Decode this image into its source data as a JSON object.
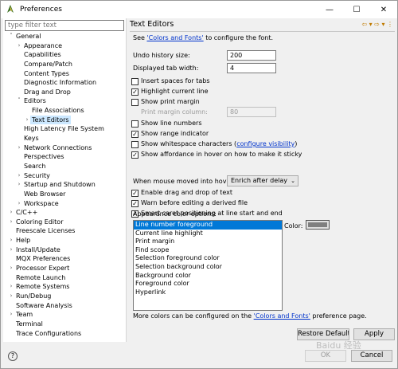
{
  "window": {
    "title": "Preferences",
    "min": "—",
    "max": "☐",
    "close": "✕"
  },
  "filter": {
    "placeholder": "type filter text"
  },
  "tree": [
    {
      "label": "General",
      "depth": 0,
      "chev": "˅"
    },
    {
      "label": "Appearance",
      "depth": 1,
      "chev": "›"
    },
    {
      "label": "Capabilities",
      "depth": 1,
      "chev": ""
    },
    {
      "label": "Compare/Patch",
      "depth": 1,
      "chev": ""
    },
    {
      "label": "Content Types",
      "depth": 1,
      "chev": ""
    },
    {
      "label": "Diagnostic Information",
      "depth": 1,
      "chev": ""
    },
    {
      "label": "Drag and Drop",
      "depth": 1,
      "chev": ""
    },
    {
      "label": "Editors",
      "depth": 1,
      "chev": "˅"
    },
    {
      "label": "File Associations",
      "depth": 2,
      "chev": ""
    },
    {
      "label": "Text Editors",
      "depth": 2,
      "chev": "›",
      "selected": true
    },
    {
      "label": "High Latency File System",
      "depth": 1,
      "chev": ""
    },
    {
      "label": "Keys",
      "depth": 1,
      "chev": ""
    },
    {
      "label": "Network Connections",
      "depth": 1,
      "chev": "›"
    },
    {
      "label": "Perspectives",
      "depth": 1,
      "chev": ""
    },
    {
      "label": "Search",
      "depth": 1,
      "chev": ""
    },
    {
      "label": "Security",
      "depth": 1,
      "chev": "›"
    },
    {
      "label": "Startup and Shutdown",
      "depth": 1,
      "chev": "›"
    },
    {
      "label": "Web Browser",
      "depth": 1,
      "chev": ""
    },
    {
      "label": "Workspace",
      "depth": 1,
      "chev": "›"
    },
    {
      "label": "C/C++",
      "depth": 0,
      "chev": "›"
    },
    {
      "label": "Coloring Editor",
      "depth": 0,
      "chev": "›"
    },
    {
      "label": "Freescale Licenses",
      "depth": 0,
      "chev": ""
    },
    {
      "label": "Help",
      "depth": 0,
      "chev": "›"
    },
    {
      "label": "Install/Update",
      "depth": 0,
      "chev": "›"
    },
    {
      "label": "MQX Preferences",
      "depth": 0,
      "chev": ""
    },
    {
      "label": "Processor Expert",
      "depth": 0,
      "chev": "›"
    },
    {
      "label": "Remote Launch",
      "depth": 0,
      "chev": ""
    },
    {
      "label": "Remote Systems",
      "depth": 0,
      "chev": "›"
    },
    {
      "label": "Run/Debug",
      "depth": 0,
      "chev": "›"
    },
    {
      "label": "Software Analysis",
      "depth": 0,
      "chev": ""
    },
    {
      "label": "Team",
      "depth": 0,
      "chev": "›"
    },
    {
      "label": "Terminal",
      "depth": 0,
      "chev": ""
    },
    {
      "label": "Trace Configurations",
      "depth": 0,
      "chev": ""
    }
  ],
  "page": {
    "title": "Text Editors",
    "nav_icons": "⇦ ▾ ⇨ ▾ ⋮",
    "see_prefix": "See ",
    "see_link": "'Colors and Fonts'",
    "see_suffix": " to configure the font.",
    "undo_label": "Undo history size:",
    "undo_value": "200",
    "tab_label": "Displayed tab width:",
    "tab_value": "4",
    "print_margin_label": "Print margin column:",
    "print_margin_value": "80",
    "hover_label": "When mouse moved into hover:",
    "hover_value": "Enrich after delay",
    "colors_label": "Appearance color options:",
    "color_label": "Color:",
    "more_prefix": "More colors can be configured on the ",
    "more_link": "'Colors and Fonts'",
    "more_suffix": " preference page.",
    "ws_link": "configure visibility"
  },
  "checks": {
    "insert_spaces": {
      "label": "Insert spaces for tabs",
      "checked": false
    },
    "highlight_line": {
      "label": "Highlight current line",
      "checked": true
    },
    "print_margin": {
      "label": "Show print margin",
      "checked": false
    },
    "line_numbers": {
      "label": "Show line numbers",
      "checked": false
    },
    "range_indicator": {
      "label": "Show range indicator",
      "checked": true
    },
    "whitespace": {
      "label": "Show whitespace characters (",
      "suffix": ")",
      "checked": false
    },
    "affordance": {
      "label": "Show affordance in hover on how to make it sticky",
      "checked": true
    },
    "drag_drop": {
      "label": "Enable drag and drop of text",
      "checked": true
    },
    "warn_derived": {
      "label": "Warn before editing a derived file",
      "checked": true
    },
    "smart_caret": {
      "label": "Smart caret positioning at line start and end",
      "checked": true
    }
  },
  "color_options": [
    {
      "label": "Line number foreground",
      "selected": true
    },
    {
      "label": "Current line highlight"
    },
    {
      "label": "Print margin"
    },
    {
      "label": "Find scope"
    },
    {
      "label": "Selection foreground color"
    },
    {
      "label": "Selection background color"
    },
    {
      "label": "Background color"
    },
    {
      "label": "Foreground color"
    },
    {
      "label": "Hyperlink"
    }
  ],
  "buttons": {
    "restore": "Restore Defaults",
    "apply": "Apply",
    "ok": "OK",
    "cancel": "Cancel",
    "help": "?"
  },
  "watermark": "Baidu 经验",
  "colors": {
    "swatch": "#7f7f7f",
    "selection": "#0078d7",
    "tree_selection": "#cce8ff",
    "link": "#0033cc"
  }
}
